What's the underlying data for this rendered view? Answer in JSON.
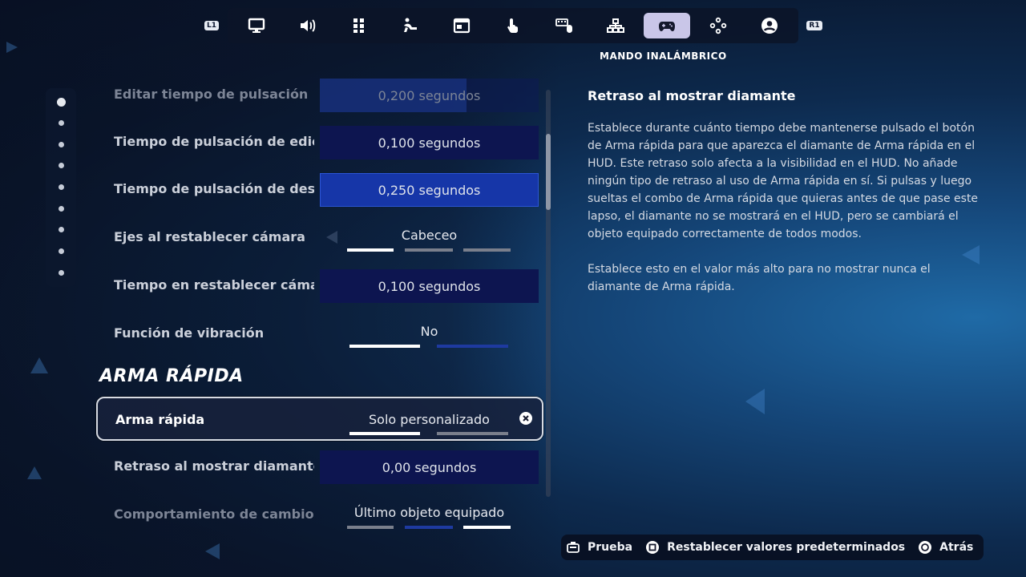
{
  "nav": {
    "left_bumper": "L1",
    "right_bumper": "R1",
    "tabs": [
      {
        "icon": "monitor-icon"
      },
      {
        "icon": "speaker-icon"
      },
      {
        "icon": "grid-icon"
      },
      {
        "icon": "accessibility-icon"
      },
      {
        "icon": "window-icon"
      },
      {
        "icon": "touch-icon"
      },
      {
        "icon": "keyboard-mouse-icon"
      },
      {
        "icon": "network-icon"
      },
      {
        "icon": "controller-icon",
        "active": true
      },
      {
        "icon": "dpad-icon"
      },
      {
        "icon": "account-icon"
      }
    ],
    "active_caption": "MANDO INALÁMBRICO"
  },
  "settings": {
    "rows": [
      {
        "label": "Editar tiempo de pulsación",
        "value": "0,200 segundos"
      },
      {
        "label": "Tiempo de pulsación de edición",
        "value": "0,100 segundos"
      },
      {
        "label": "Tiempo de pulsación de deslizamiento",
        "value": "0,250 segundos"
      },
      {
        "label": "Ejes al restablecer cámara",
        "value": "Cabeceo",
        "options_count": 3,
        "selected_index": 0
      },
      {
        "label": "Tiempo en restablecer cámara",
        "value": "0,100 segundos"
      },
      {
        "label": "Función de vibración",
        "value": "No",
        "options_count": 2,
        "selected_index": 0
      },
      {
        "label": "Arma rápida",
        "value": "Solo personalizado",
        "options_count": 2,
        "selected_index": 0
      },
      {
        "label": "Retraso al mostrar diamante",
        "value": "0,00 segundos"
      },
      {
        "label": "Comportamiento de cambio",
        "value": "Último objeto equipado",
        "options_count": 3,
        "selected_index": 2
      }
    ],
    "section_title": "ARMA RÁPIDA"
  },
  "description": {
    "title": "Retraso al mostrar diamante",
    "paragraphs": [
      "Establece durante cuánto tiempo debe mantenerse pulsado el botón de Arma rápida para que aparezca el diamante de Arma rápida en el HUD. Este retraso solo afecta a la visibilidad en el HUD. No añade ningún tipo de retraso al uso de Arma rápida en sí. Si pulsas y luego sueltas el combo de Arma rápida que quieras antes de que pase este lapso, el diamante no se mostrará en el HUD, pero se cambiará el objeto equipado correctamente de todos modos.",
      "Establece esto en el valor más alto para no mostrar nunca el diamante de Arma rápida."
    ]
  },
  "actions": {
    "test": "Prueba",
    "reset": "Restablecer valores predeterminados",
    "back": "Atrás"
  },
  "colors": {
    "accent_blue": "#1636a8",
    "tab_active_bg": "#c9c6e8",
    "value_box_bg": "#0d1550"
  }
}
